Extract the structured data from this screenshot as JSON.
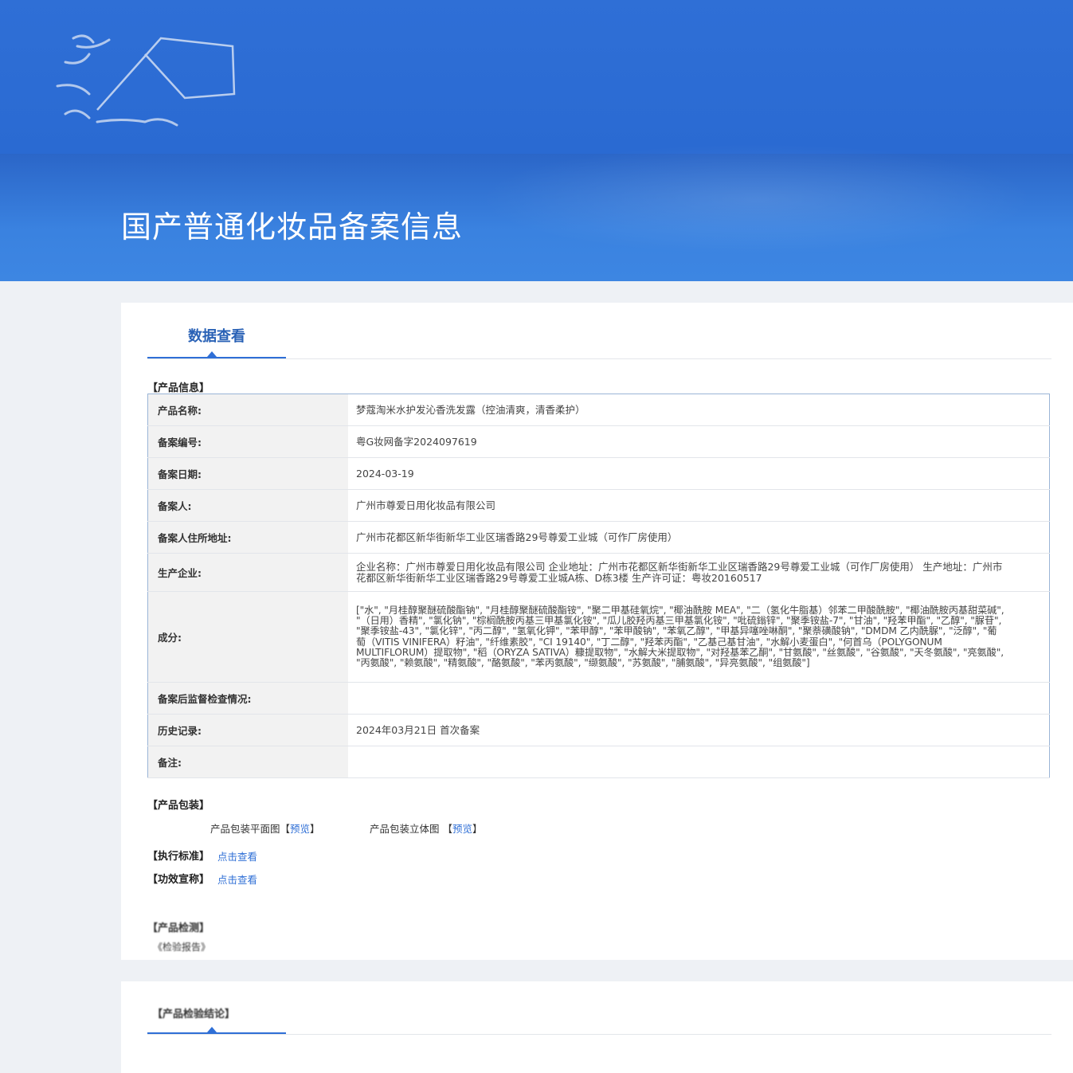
{
  "banner": {
    "title": "国产普通化妆品备案信息"
  },
  "tab": {
    "label": "数据查看"
  },
  "product_info": {
    "section_title": "【产品信息】",
    "rows": [
      {
        "label": "产品名称:",
        "value": "梦蔻淘米水护发沁香洗发露（控油清爽，清香柔护）"
      },
      {
        "label": "备案编号:",
        "value": "粤G妆网备字2024097619"
      },
      {
        "label": "备案日期:",
        "value": "2024-03-19"
      },
      {
        "label": "备案人:",
        "value": "广州市尊爱日用化妆品有限公司"
      },
      {
        "label": "备案人住所地址:",
        "value": "广州市花都区新华街新华工业区瑞香路29号尊爱工业城（可作厂房使用）"
      },
      {
        "label": "生产企业:",
        "value": "企业名称：广州市尊爱日用化妆品有限公司 企业地址：广州市花都区新华街新华工业区瑞香路29号尊爱工业城（可作厂房使用） 生产地址：广州市花都区新华街新华工业区瑞香路29号尊爱工业城A栋、D栋3楼 生产许可证：粤妆20160517"
      },
      {
        "label": "成分:",
        "value": "[\"水\", \"月桂醇聚醚硫酸酯钠\", \"月桂醇聚醚硫酸酯铵\", \"聚二甲基硅氧烷\", \"椰油酰胺 MEA\", \"二（氢化牛脂基）邻苯二甲酸酰胺\", \"椰油酰胺丙基甜菜碱\", \"（日用）香精\", \"氯化钠\", \"棕榈酰胺丙基三甲基氯化铵\", \"瓜儿胶羟丙基三甲基氯化铵\", \"吡硫鎓锌\", \"聚季铵盐-7\", \"甘油\", \"羟苯甲酯\", \"乙醇\", \"脲苷\", \"聚季铵盐-43\", \"氯化锌\", \"丙二醇\", \"氢氧化钾\", \"苯甲醇\", \"苯甲酸钠\", \"苯氧乙醇\", \"甲基异噻唑啉酮\", \"聚萘磺酸钠\", \"DMDM 乙内酰脲\", \"泛醇\", \"葡萄（VITIS VINIFERA）籽油\", \"纤维素胶\", \"CI 19140\", \"丁二醇\", \"羟苯丙酯\", \"乙基己基甘油\", \"水解小麦蛋白\", \"何首乌（POLYGONUM MULTIFLORUM）提取物\", \"稻（ORYZA SATIVA）糠提取物\", \"水解大米提取物\", \"对羟基苯乙酮\", \"甘氨酸\", \"丝氨酸\", \"谷氨酸\", \"天冬氨酸\", \"亮氨酸\", \"丙氨酸\", \"赖氨酸\", \"精氨酸\", \"酪氨酸\", \"苯丙氨酸\", \"缬氨酸\", \"苏氨酸\", \"脯氨酸\", \"异亮氨酸\", \"组氨酸\"]"
      },
      {
        "label": "备案后监督检查情况:",
        "value": ""
      },
      {
        "label": "历史记录:",
        "value": "2024年03月21日 首次备案"
      },
      {
        "label": "备注:",
        "value": ""
      }
    ]
  },
  "packaging": {
    "section_title": "【产品包装】",
    "flat_label": "产品包装平面图",
    "solid_label": "产品包装立体图",
    "preview_link": "预览",
    "bracket_open": "【",
    "bracket_close": "】"
  },
  "standard": {
    "section_title": "【执行标准】",
    "link": "点击查看"
  },
  "efficacy": {
    "section_title": "【功效宣称】",
    "link": "点击查看"
  },
  "faded": {
    "section_title": "【产品检测】",
    "sub_text": "《检验报告》",
    "panel2_title": "【产品检验结论】"
  }
}
